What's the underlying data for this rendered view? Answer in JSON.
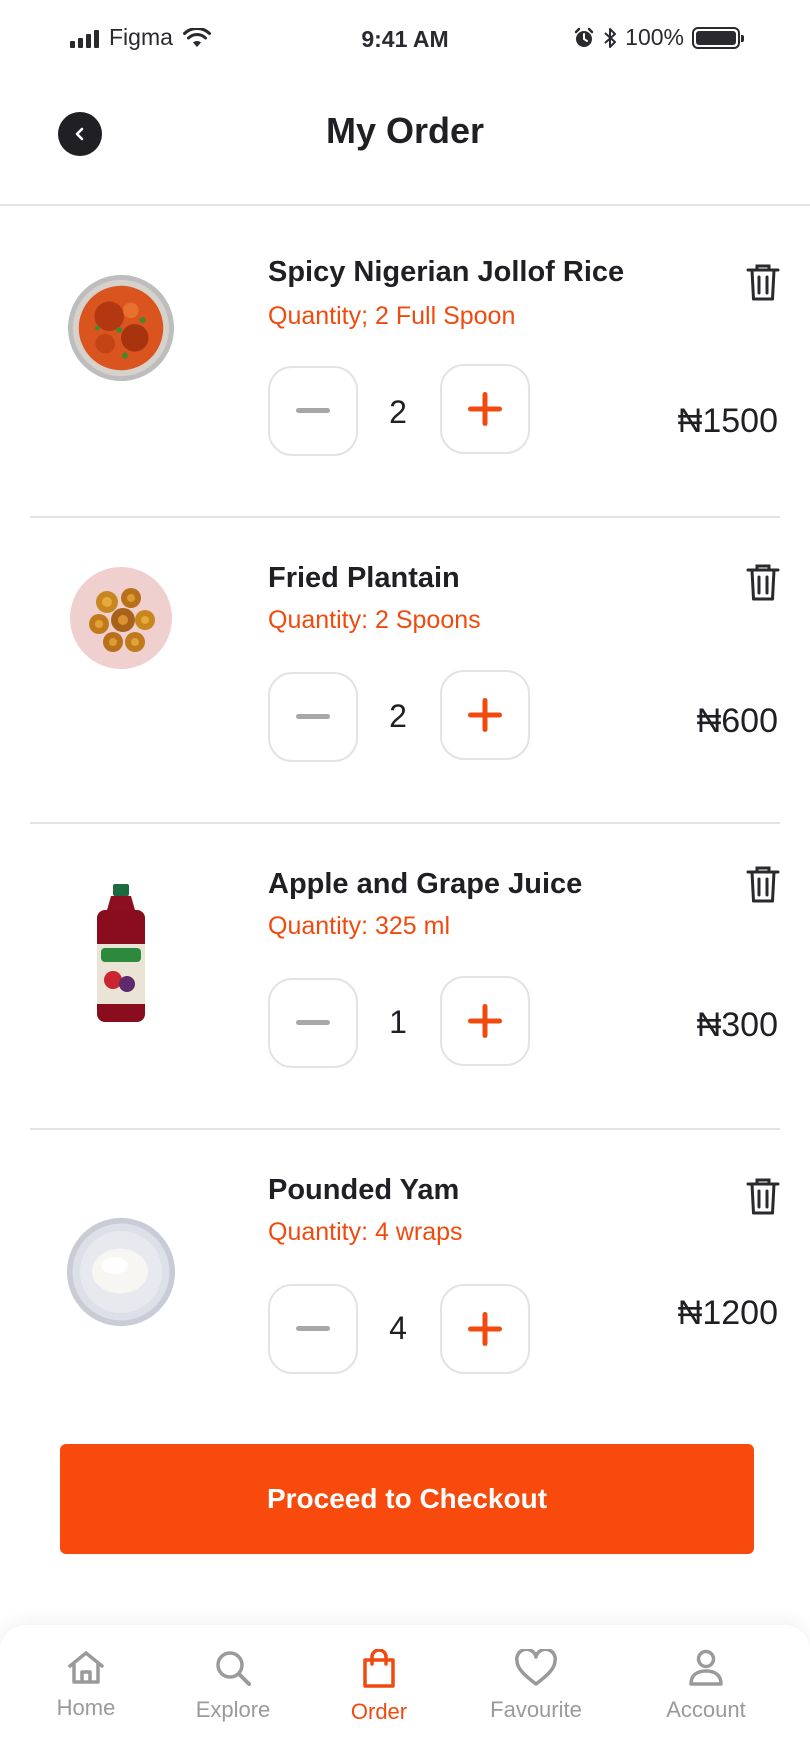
{
  "status_bar": {
    "carrier": "Figma",
    "time": "9:41 AM",
    "battery": "100%"
  },
  "header": {
    "title": "My Order"
  },
  "items": [
    {
      "name": "Spicy Nigerian Jollof Rice",
      "quantity_label": "Quantity; 2 Full Spoon",
      "count": "2",
      "price": "₦1500",
      "image": "jollof-rice-image"
    },
    {
      "name": "Fried Plantain",
      "quantity_label": "Quantity: 2 Spoons",
      "count": "2",
      "price": "₦600",
      "image": "fried-plantain-image"
    },
    {
      "name": "Apple and Grape Juice",
      "quantity_label": "Quantity: 325 ml",
      "count": "1",
      "price": "₦300",
      "image": "juice-bottle-image"
    },
    {
      "name": "Pounded Yam",
      "quantity_label": "Quantity: 4 wraps",
      "count": "4",
      "price": "₦1200",
      "image": "pounded-yam-image"
    }
  ],
  "checkout": {
    "label": "Proceed to Checkout"
  },
  "nav": [
    {
      "label": "Home",
      "icon": "home-icon"
    },
    {
      "label": "Explore",
      "icon": "search-icon"
    },
    {
      "label": "Order",
      "icon": "shopping-bag-icon",
      "active": true
    },
    {
      "label": "Favourite",
      "icon": "heart-icon"
    },
    {
      "label": "Account",
      "icon": "user-icon"
    }
  ],
  "colors": {
    "accent": "#f74a0c",
    "accent_text": "#f04a0f",
    "dark": "#1f1f24",
    "muted": "#9a9a9a",
    "border": "#e3e3e3"
  }
}
